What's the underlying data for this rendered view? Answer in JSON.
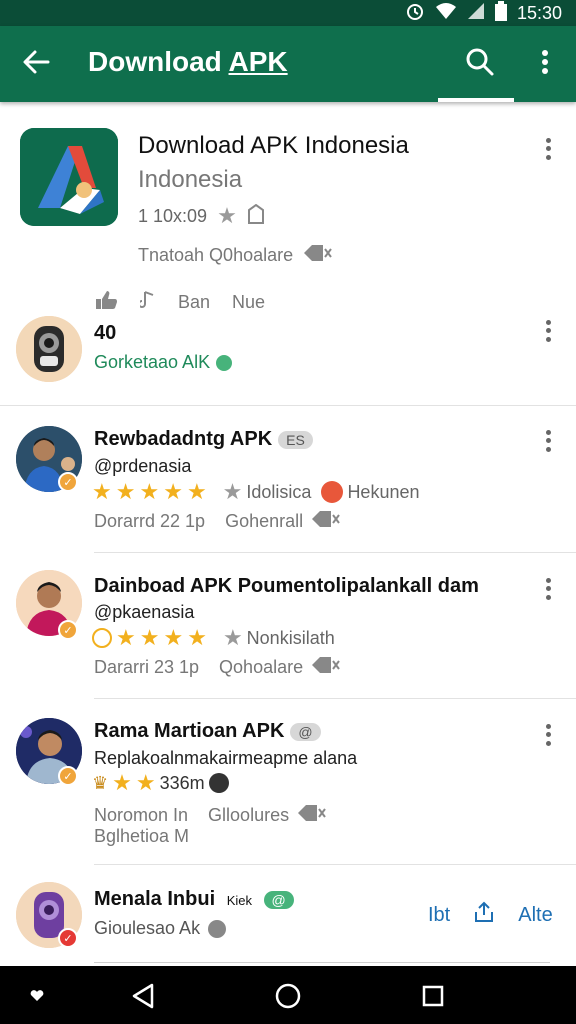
{
  "status": {
    "time": "15:30"
  },
  "appbar": {
    "title_plain": "Download ",
    "title_underline": "APK"
  },
  "hero": {
    "title": "Download APK Indonesia",
    "subtitle": "Indonesia",
    "meta": "1 10x:09",
    "tags": "Tnatoah  Q0hoalare",
    "avatar_number": "40",
    "avatar_label": "Gorketaao AlK",
    "actions": [
      "Ban",
      "Nue"
    ]
  },
  "reviews": [
    {
      "name": "Rewbadadntg APK",
      "pill": "ES",
      "handle": "@prdenasia",
      "stars": 5,
      "after_stars": "Idolisica",
      "tag2": "Hekunen",
      "meta_left": "Dorarrd 22  1p",
      "meta_right": "Gohenrall"
    },
    {
      "name": "Dainboad APK Poumentolipalankall dam",
      "handle": "@pkaenasia",
      "stars": 4,
      "after_stars": "Nonkisilath",
      "meta_left": "Dararri 23  1p",
      "meta_right": "Qohoalare"
    },
    {
      "name": "Rama Martioan APK",
      "pill": "@",
      "handle": "Replakoalnmakairmeapme alana",
      "rating_text": "336m",
      "meta_left": "Noromon  In",
      "meta_right": "Glloolures",
      "meta_line2": "Bglhetioa  M"
    },
    {
      "name": "Menala Inbui",
      "small_tag": "Kiek",
      "pill": "@",
      "handle": "Gioulesao Ak",
      "actions": [
        "Ibt",
        "Alte"
      ]
    }
  ],
  "colors": {
    "primary": "#0f6f4d",
    "status": "#0b4d37",
    "star": "#f2b01e",
    "link": "#1e6fb3"
  }
}
